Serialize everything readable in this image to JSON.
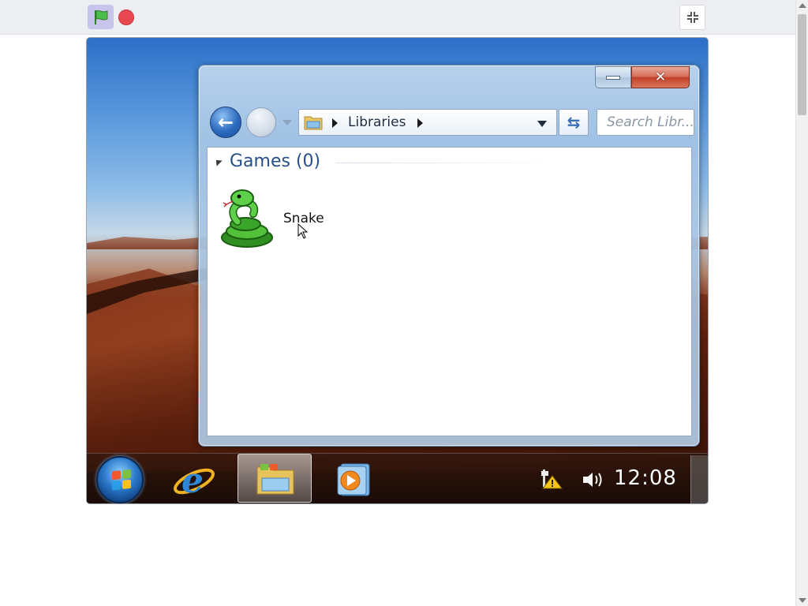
{
  "player": {
    "flag_icon": "green-flag-icon",
    "stop_icon": "stop-icon",
    "fullscreen_icon": "exit-fullscreen-icon"
  },
  "explorer": {
    "address": {
      "location": "Libraries"
    },
    "search": {
      "placeholder": "Search Libr..."
    },
    "group": {
      "title": "Games (0)"
    },
    "items": [
      {
        "label": "Snake",
        "icon": "snake-icon"
      }
    ]
  },
  "taskbar": {
    "clock": "12:08",
    "pinned": [
      "start-orb-icon",
      "internet-explorer-icon",
      "windows-explorer-icon",
      "media-player-icon"
    ],
    "tray": [
      "network-warning-icon",
      "volume-icon"
    ]
  },
  "colors": {
    "group_title": "#27508b",
    "close_button": "#c2412a",
    "stop_button": "#e8474f",
    "flag_button_bg": "#c8c4ec"
  }
}
